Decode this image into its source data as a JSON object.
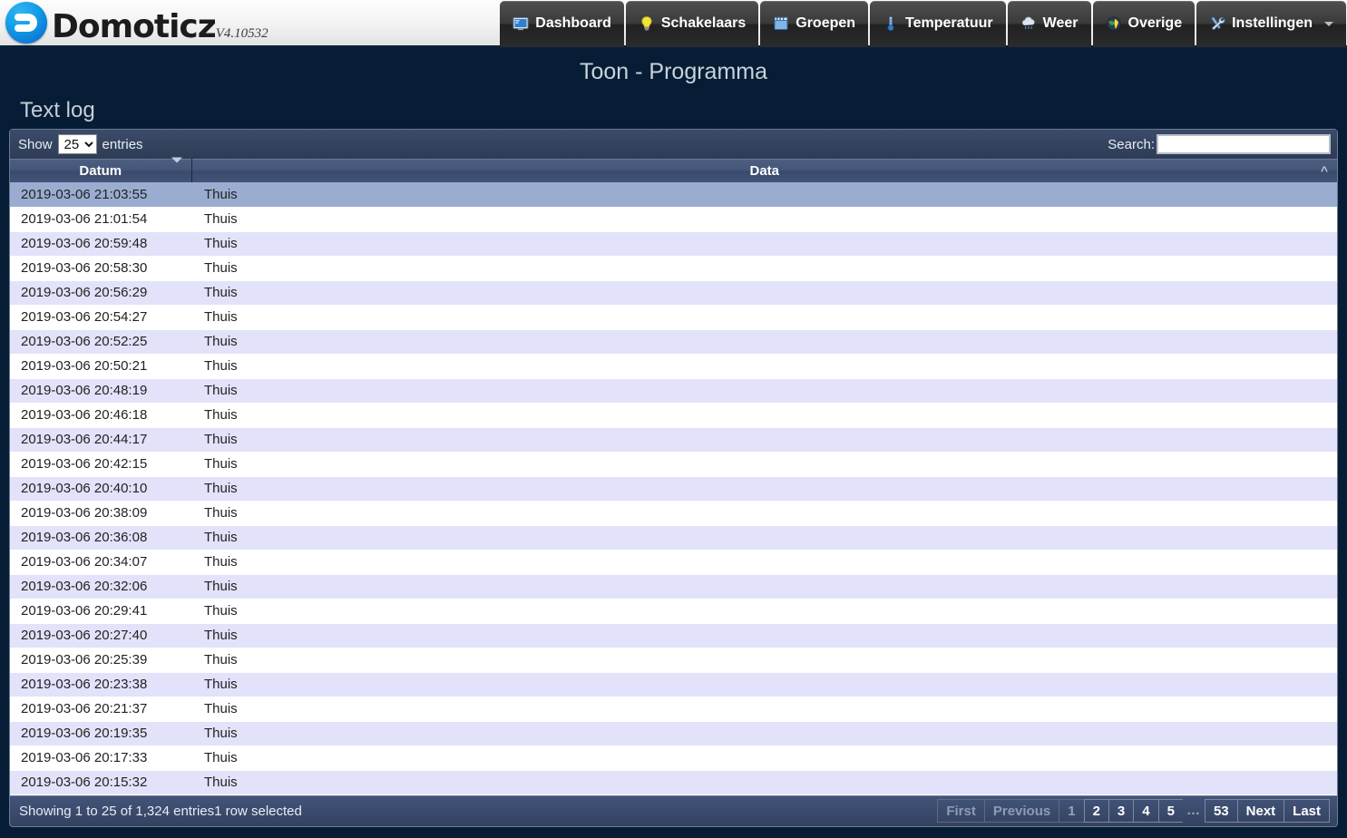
{
  "brand": {
    "name": "Domoticz",
    "version": "V4.10532",
    "logo_icon": "domoticz-logo-icon"
  },
  "nav": {
    "items": [
      {
        "label": "Dashboard",
        "icon": "monitor-icon"
      },
      {
        "label": "Schakelaars",
        "icon": "lightbulb-icon"
      },
      {
        "label": "Groepen",
        "icon": "clapperboard-icon"
      },
      {
        "label": "Temperatuur",
        "icon": "thermometer-icon"
      },
      {
        "label": "Weer",
        "icon": "rain-cloud-icon"
      },
      {
        "label": "Overige",
        "icon": "globe-icon"
      },
      {
        "label": "Instellingen",
        "icon": "tools-icon",
        "has_caret": true
      }
    ]
  },
  "page": {
    "title": "Toon - Programma"
  },
  "section": {
    "title": "Text log"
  },
  "controls": {
    "show_label": "Show",
    "entries_label": "entries",
    "page_length_selected": "25",
    "page_length_options": [
      "25"
    ],
    "search_label": "Search:",
    "search_value": "",
    "search_placeholder": ""
  },
  "table": {
    "columns": [
      {
        "key": "datum",
        "label": "Datum",
        "sort": "desc"
      },
      {
        "key": "data",
        "label": "Data",
        "sort": "asc"
      }
    ],
    "rows": [
      {
        "datum": "2019-03-06 21:03:55",
        "data": "Thuis",
        "selected": true
      },
      {
        "datum": "2019-03-06 21:01:54",
        "data": "Thuis",
        "selected": false
      },
      {
        "datum": "2019-03-06 20:59:48",
        "data": "Thuis",
        "selected": false
      },
      {
        "datum": "2019-03-06 20:58:30",
        "data": "Thuis",
        "selected": false
      },
      {
        "datum": "2019-03-06 20:56:29",
        "data": "Thuis",
        "selected": false
      },
      {
        "datum": "2019-03-06 20:54:27",
        "data": "Thuis",
        "selected": false
      },
      {
        "datum": "2019-03-06 20:52:25",
        "data": "Thuis",
        "selected": false
      },
      {
        "datum": "2019-03-06 20:50:21",
        "data": "Thuis",
        "selected": false
      },
      {
        "datum": "2019-03-06 20:48:19",
        "data": "Thuis",
        "selected": false
      },
      {
        "datum": "2019-03-06 20:46:18",
        "data": "Thuis",
        "selected": false
      },
      {
        "datum": "2019-03-06 20:44:17",
        "data": "Thuis",
        "selected": false
      },
      {
        "datum": "2019-03-06 20:42:15",
        "data": "Thuis",
        "selected": false
      },
      {
        "datum": "2019-03-06 20:40:10",
        "data": "Thuis",
        "selected": false
      },
      {
        "datum": "2019-03-06 20:38:09",
        "data": "Thuis",
        "selected": false
      },
      {
        "datum": "2019-03-06 20:36:08",
        "data": "Thuis",
        "selected": false
      },
      {
        "datum": "2019-03-06 20:34:07",
        "data": "Thuis",
        "selected": false
      },
      {
        "datum": "2019-03-06 20:32:06",
        "data": "Thuis",
        "selected": false
      },
      {
        "datum": "2019-03-06 20:29:41",
        "data": "Thuis",
        "selected": false
      },
      {
        "datum": "2019-03-06 20:27:40",
        "data": "Thuis",
        "selected": false
      },
      {
        "datum": "2019-03-06 20:25:39",
        "data": "Thuis",
        "selected": false
      },
      {
        "datum": "2019-03-06 20:23:38",
        "data": "Thuis",
        "selected": false
      },
      {
        "datum": "2019-03-06 20:21:37",
        "data": "Thuis",
        "selected": false
      },
      {
        "datum": "2019-03-06 20:19:35",
        "data": "Thuis",
        "selected": false
      },
      {
        "datum": "2019-03-06 20:17:33",
        "data": "Thuis",
        "selected": false
      },
      {
        "datum": "2019-03-06 20:15:32",
        "data": "Thuis",
        "selected": false
      }
    ]
  },
  "footer": {
    "info": "Showing 1 to 25 of 1,324 entries1 row selected",
    "pagination": [
      {
        "label": "First",
        "state": "disabled"
      },
      {
        "label": "Previous",
        "state": "disabled"
      },
      {
        "label": "1",
        "state": "current"
      },
      {
        "label": "2",
        "state": "normal"
      },
      {
        "label": "3",
        "state": "normal"
      },
      {
        "label": "4",
        "state": "normal"
      },
      {
        "label": "5",
        "state": "normal"
      },
      {
        "label": "…",
        "state": "ellipsis"
      },
      {
        "label": "53",
        "state": "normal"
      },
      {
        "label": "Next",
        "state": "normal"
      },
      {
        "label": "Last",
        "state": "normal"
      }
    ]
  },
  "colors": {
    "page_background": "#071d35",
    "selected_row": "#9aadd1",
    "stripe_row": "#e2e2fa",
    "accent_blue": "#129fe8"
  }
}
